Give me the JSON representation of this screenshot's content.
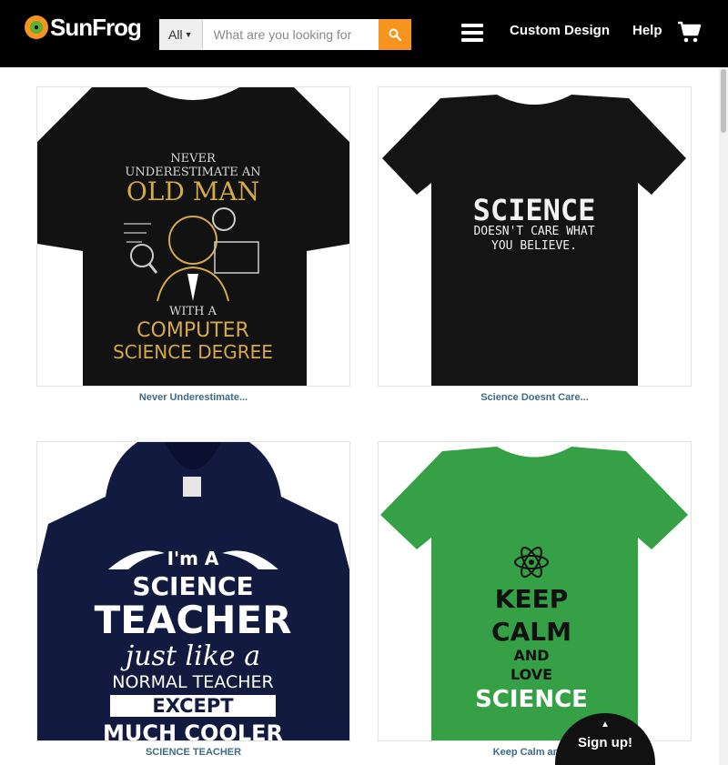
{
  "header": {
    "brand": "SunFrog",
    "search_category": "All",
    "search_placeholder": "What are you looking for",
    "nav": {
      "custom_design": "Custom Design",
      "help": "Help"
    }
  },
  "products": [
    {
      "title": "Never Underestimate...",
      "shirt": {
        "type": "tee",
        "color": "#121212"
      },
      "print": {
        "line1": "NEVER",
        "line2": "UNDERESTIMATE AN",
        "line3": "OLD MAN",
        "line4": "WITH A",
        "line5": "COMPUTER",
        "line6": "SCIENCE DEGREE"
      }
    },
    {
      "title": "Science Doesnt Care...",
      "shirt": {
        "type": "tee",
        "color": "#141414"
      },
      "print": {
        "line1": "SCIENCE",
        "line2": "DOESN'T CARE WHAT",
        "line3": "YOU BELIEVE."
      }
    },
    {
      "title": "SCIENCE TEACHER",
      "shirt": {
        "type": "hoodie",
        "color": "#121a3f"
      },
      "print": {
        "line1": "I'm A",
        "line2": "SCIENCE",
        "line3": "TEACHER",
        "line4": "just like a",
        "line5": "NORMAL TEACHER",
        "line6": "EXCEPT",
        "line7": "MUCH COOLER"
      }
    },
    {
      "title": "Keep Calm and ...",
      "shirt": {
        "type": "tee",
        "color": "#35a045"
      },
      "print": {
        "line1": "KEEP",
        "line2": "CALM",
        "line3": "AND",
        "line4": "LOVE",
        "line5": "SCIENCE"
      }
    }
  ],
  "signup": {
    "label": "Sign up!"
  },
  "colors": {
    "header_bg": "#000000",
    "accent": "#f7941d",
    "link": "#3f6a88"
  }
}
